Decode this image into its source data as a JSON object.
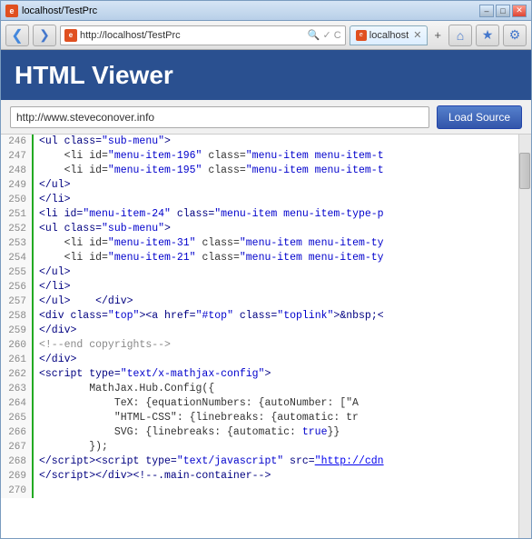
{
  "window": {
    "title": "localhost/TestPrc",
    "tab_label": "localhost"
  },
  "browser": {
    "address": "http://localhost/TestPrc",
    "search_placeholder": "P ✓ C"
  },
  "header": {
    "title": "HTML Viewer"
  },
  "url_bar": {
    "url": "http://www.steveconover.info",
    "load_button": "Load Source"
  },
  "code_lines": [
    {
      "num": "246",
      "html": "<span class='tag'>&lt;ul class=<span class='val'>\"sub-menu\"</span>&gt;</span>"
    },
    {
      "num": "247",
      "html": "<span class='text-content'>&nbsp;&nbsp;&nbsp;&nbsp;&lt;li id=<span class='val'>\"menu-item-196\"</span> class=<span class='val'>\"menu-item menu-item-t</span></span>"
    },
    {
      "num": "248",
      "html": "<span class='text-content'>&nbsp;&nbsp;&nbsp;&nbsp;&lt;li id=<span class='val'>\"menu-item-195\"</span> class=<span class='val'>\"menu-item menu-item-t</span></span>"
    },
    {
      "num": "249",
      "html": "<span class='tag'>&lt;/ul&gt;</span>"
    },
    {
      "num": "250",
      "html": "<span class='tag'>&lt;/li&gt;</span>"
    },
    {
      "num": "251",
      "html": "<span class='tag'>&lt;li id=<span class='val'>\"menu-item-24\"</span> class=<span class='val'>\"menu-item menu-item-type-p</span></span>"
    },
    {
      "num": "252",
      "html": "<span class='tag'>&lt;ul class=<span class='val'>\"sub-menu\"</span>&gt;</span>"
    },
    {
      "num": "253",
      "html": "<span class='text-content'>&nbsp;&nbsp;&nbsp;&nbsp;&lt;li id=<span class='val'>\"menu-item-31\"</span> class=<span class='val'>\"menu-item menu-item-ty</span></span>"
    },
    {
      "num": "254",
      "html": "<span class='text-content'>&nbsp;&nbsp;&nbsp;&nbsp;&lt;li id=<span class='val'>\"menu-item-21\"</span> class=<span class='val'>\"menu-item menu-item-ty</span></span>"
    },
    {
      "num": "255",
      "html": "<span class='tag'>&lt;/ul&gt;</span>"
    },
    {
      "num": "256",
      "html": "<span class='tag'>&lt;/li&gt;</span>"
    },
    {
      "num": "257",
      "html": "<span class='tag'>&lt;/ul&gt;&nbsp;&nbsp;&nbsp;&nbsp;&lt;/div&gt;</span>"
    },
    {
      "num": "258",
      "html": "<span class='tag'>&lt;div class=<span class='val'>\"top\"</span>&gt;&lt;a href=<span class='val'>\"#top\"</span> class=<span class='val'>\"toplink\"</span>&gt;&amp;nbsp;&lt;</span>"
    },
    {
      "num": "259",
      "html": "<span class='tag'>&lt;/div&gt;</span>"
    },
    {
      "num": "260",
      "html": "<span class='comment'>&lt;!--end copyrights--&gt;</span>"
    },
    {
      "num": "261",
      "html": "<span class='tag'>&lt;/div&gt;</span>"
    },
    {
      "num": "262",
      "html": "<span class='tag'>&lt;script type=<span class='val'>\"text/x-mathjax-config\"</span>&gt;</span>"
    },
    {
      "num": "263",
      "html": "<span class='text-content'>&nbsp;&nbsp;&nbsp;&nbsp;&nbsp;&nbsp;&nbsp;&nbsp;MathJax.Hub.Config({</span>"
    },
    {
      "num": "264",
      "html": "<span class='text-content'>&nbsp;&nbsp;&nbsp;&nbsp;&nbsp;&nbsp;&nbsp;&nbsp;&nbsp;&nbsp;&nbsp;&nbsp;TeX: {equationNumbers: {autoNumber: [\"A</span>"
    },
    {
      "num": "265",
      "html": "<span class='text-content'>&nbsp;&nbsp;&nbsp;&nbsp;&nbsp;&nbsp;&nbsp;&nbsp;&nbsp;&nbsp;&nbsp;&nbsp;\"HTML-CSS\": {linebreaks: {automatic: tr</span>"
    },
    {
      "num": "266",
      "html": "<span class='text-content'>&nbsp;&nbsp;&nbsp;&nbsp;&nbsp;&nbsp;&nbsp;&nbsp;&nbsp;&nbsp;&nbsp;&nbsp;SVG: {linebreaks: {automatic: <span class='val'>true</span>}}</span>"
    },
    {
      "num": "267",
      "html": "<span class='text-content'>&nbsp;&nbsp;&nbsp;&nbsp;&nbsp;&nbsp;&nbsp;&nbsp;});</span>"
    },
    {
      "num": "268",
      "html": "<span class='tag'>&lt;/script&gt;&lt;script type=<span class='val'>\"text/javascript\"</span> src=<span class='val'><span class='link'>\"http://cdn</span></span></span>"
    },
    {
      "num": "269",
      "html": "<span class='tag'>&lt;/script&gt;&lt;/div&gt;&lt;!--.main-container--&gt;</span>"
    },
    {
      "num": "270",
      "html": ""
    }
  ],
  "colors": {
    "header_bg": "#2a5090",
    "line_border": "#22aa22"
  }
}
